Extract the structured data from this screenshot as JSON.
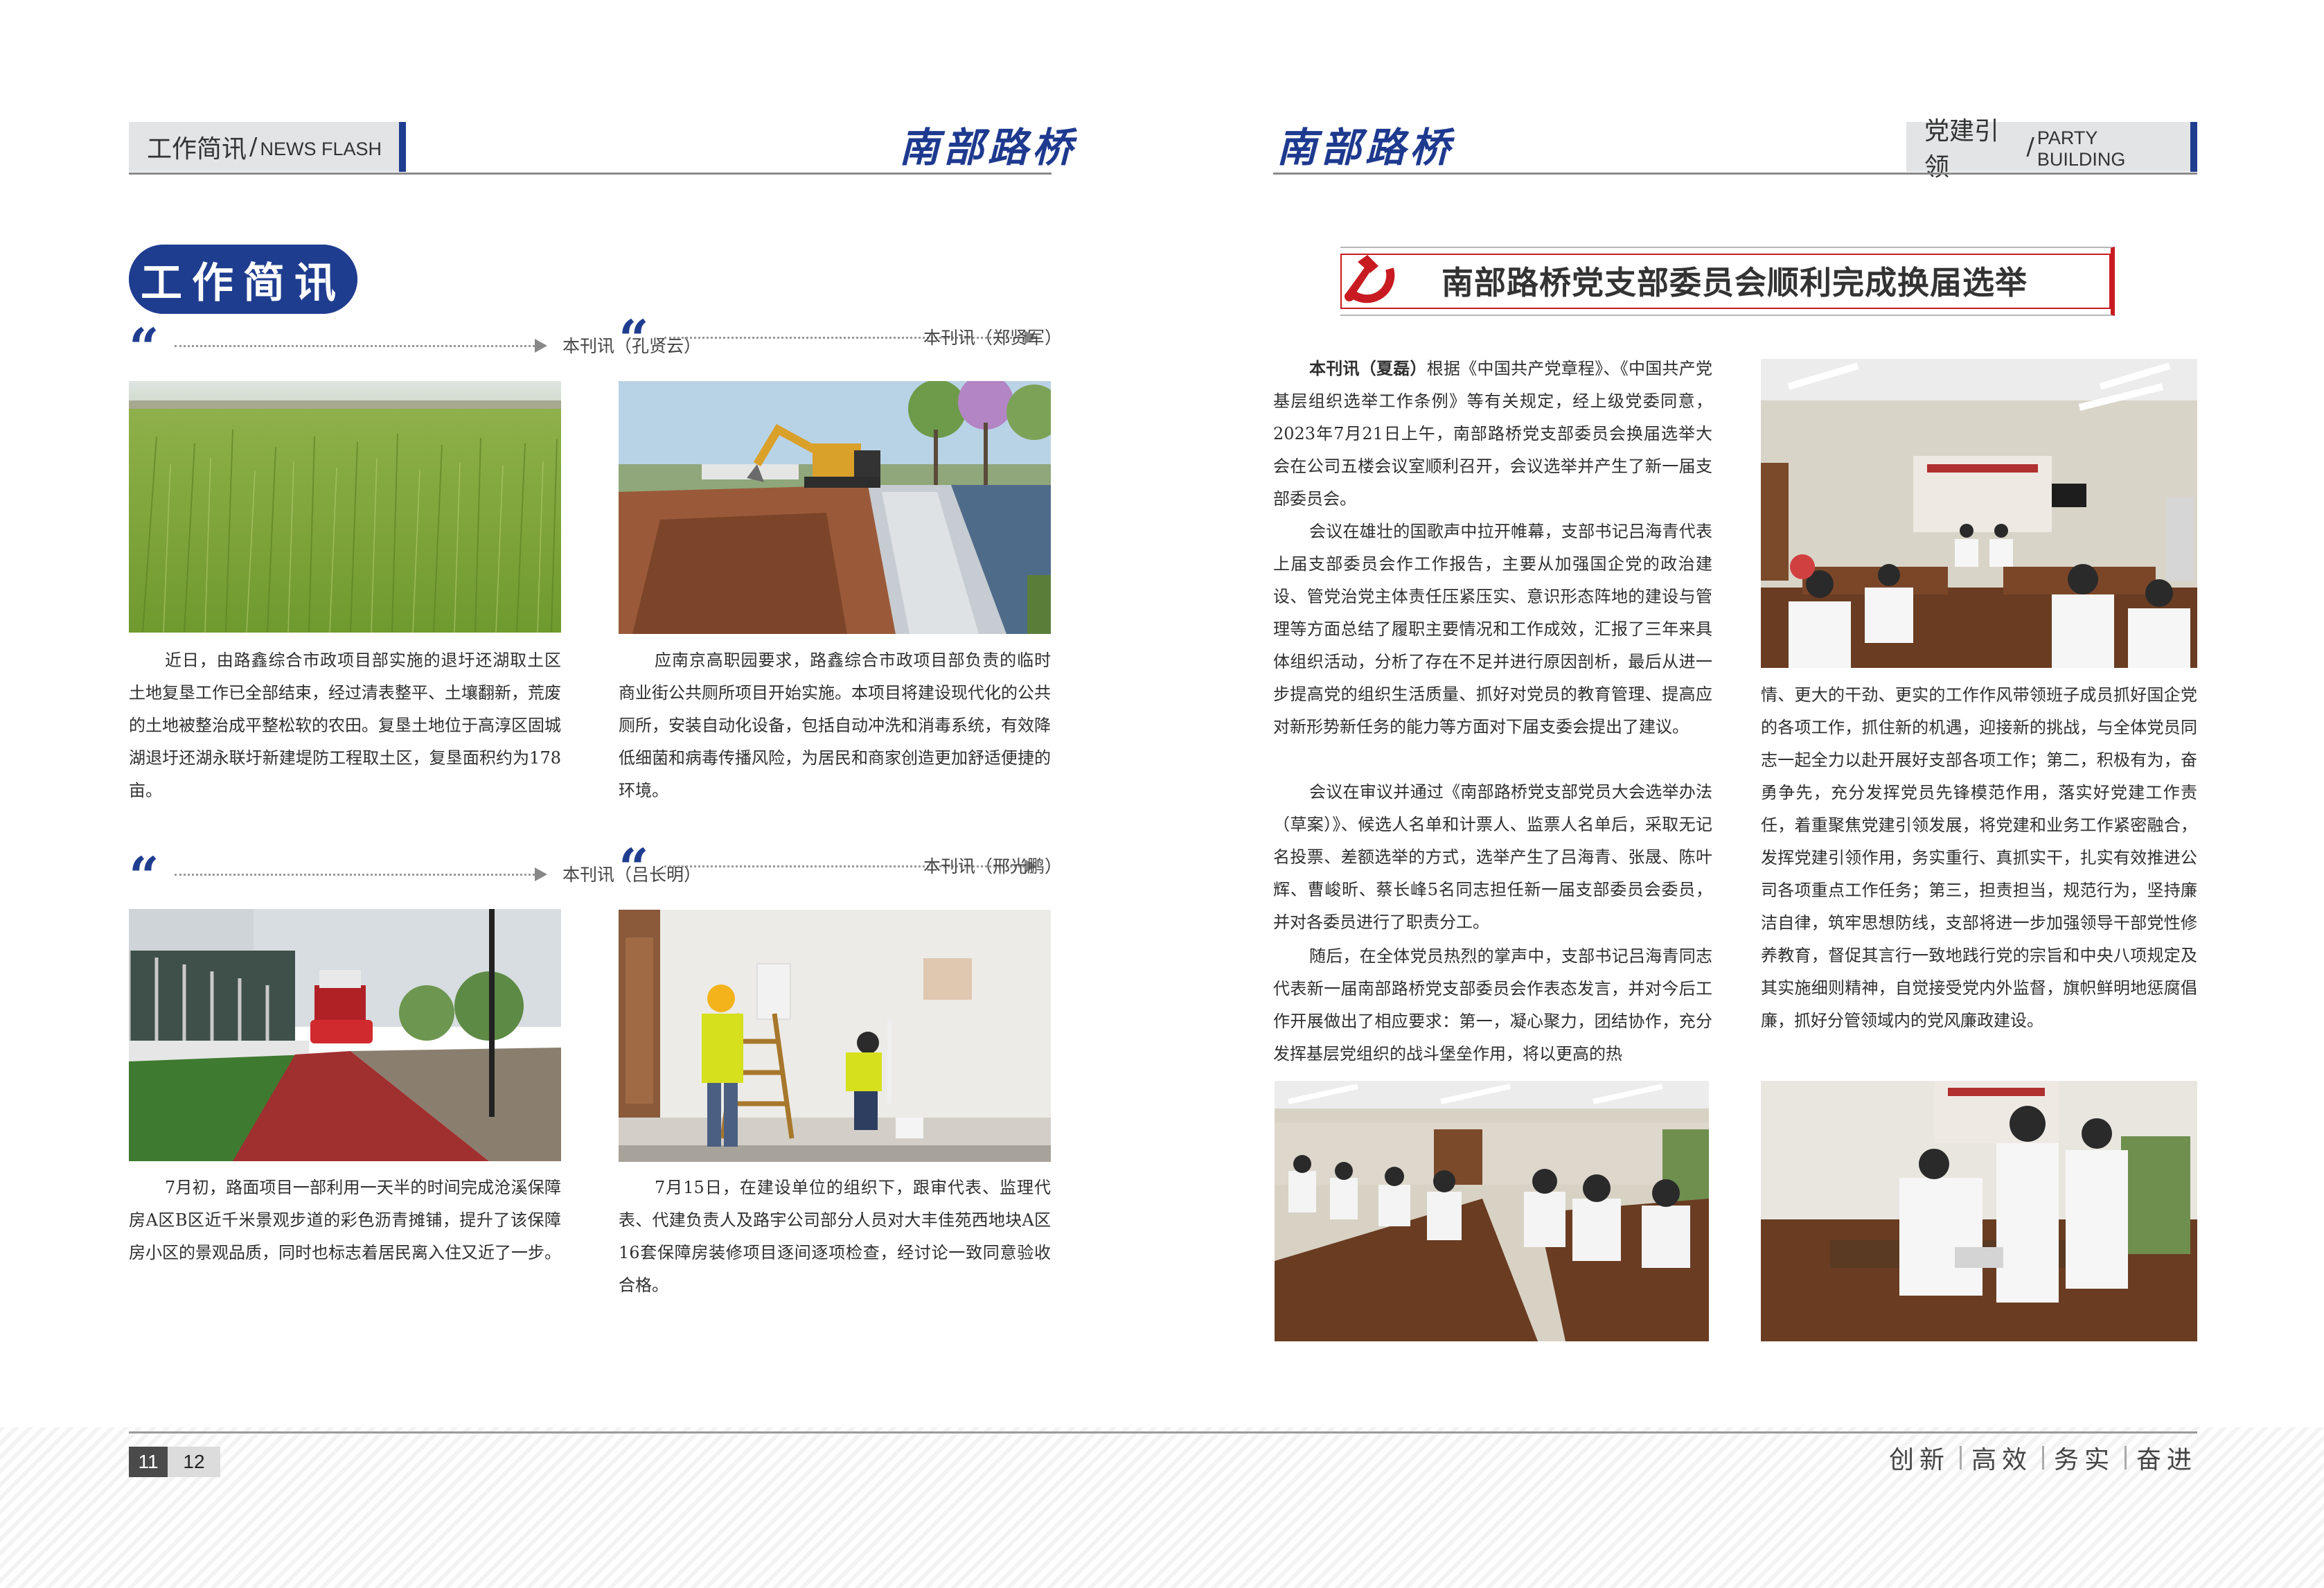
{
  "left_header": {
    "section_zh": "工作简讯",
    "section_en": "NEWS FLASH",
    "brand": "南部路桥"
  },
  "right_header": {
    "section_zh": "党建引领",
    "section_en": "PARTY BUILDING",
    "brand": "南部路桥"
  },
  "news_title": "工作简讯",
  "news": [
    {
      "byline": "本刊讯（孔贤云）",
      "photo": "rice-field-photo",
      "text": "近日，由路鑫综合市政项目部实施的退圩还湖取土区土地复垦工作已全部结束，经过清表整平、土壤翻新，荒废的土地被整治成平整松软的农田。复垦土地位于高淳区固城湖退圩还湖永联圩新建堤防工程取土区，复垦面积约为178亩。"
    },
    {
      "byline": "本刊讯（郑贤军）",
      "photo": "excavator-photo",
      "text": "应南京高职园要求，路鑫综合市政项目部负责的临时商业街公共厕所项目开始实施。本项目将建设现代化的公共厕所，安装自动化设备，包括自动冲洗和消毒系统，有效降低细菌和病毒传播风险，为居民和商家创造更加舒适便捷的环境。"
    },
    {
      "byline": "本刊讯（吕长明）",
      "photo": "road-roller-photo",
      "text": "7月初，路面项目一部利用一天半的时间完成沧溪保障房A区B区近千米景观步道的彩色沥青摊铺，提升了该保障房小区的景观品质，同时也标志着居民离入住又近了一步。"
    },
    {
      "byline": "本刊讯（邢光鹏）",
      "photo": "inspection-photo",
      "text": "7月15日，在建设单位的组织下，跟审代表、监理代表、代建负责人及路宇公司部分人员对大丰佳苑西地块A区16套保障房装修项目逐间逐项检查，经讨论一致同意验收合格。"
    }
  ],
  "article": {
    "title": "南部路桥党支部委员会顺利完成换届选举",
    "byline": "本刊讯（夏磊）",
    "p1": "根据《中国共产党章程》、《中国共产党基层组织选举工作条例》等有关规定，经上级党委同意，2023年7月21日上午，南部路桥党支部委员会换届选举大会在公司五楼会议室顺利召开，会议选举并产生了新一届支部委员会。",
    "p2": "会议在雄壮的国歌声中拉开帷幕，支部书记吕海青代表上届支部委员会作工作报告，主要从加强国企党的政治建设、管党治党主体责任压紧压实、意识形态阵地的建设与管理等方面总结了履职主要情况和工作成效，汇报了三年来具体组织活动，分析了存在不足并进行原因剖析，最后从进一步提高党的组织生活质量、抓好对党员的教育管理、提高应对新形势新任务的能力等方面对下届支委会提出了建议。",
    "p3": "会议在审议并通过《南部路桥党支部党员大会选举办法（草案）》、候选人名单和计票人、监票人名单后，采取无记名投票、差额选举的方式，选举产生了吕海青、张晟、陈叶辉、曹峻昕、蔡长峰5名同志担任新一届支部委员会委员，并对各委员进行了职责分工。",
    "p4": "随后，在全体党员热烈的掌声中，支部书记吕海青同志代表新一届南部路桥党支部委员会作表态发言，并对今后工作开展做出了相应要求：第一，凝心聚力，团结协作，充分发挥基层党组织的战斗堡垒作用，将以更高的热",
    "p4_cont": "情、更大的干劲、更实的工作作风带领班子成员抓好国企党的各项工作，抓住新的机遇，迎接新的挑战，与全体党员同志一起全力以赴开展好支部各项工作；第二，积极有为，奋勇争先，充分发挥党员先锋模范作用，落实好党建工作责任，着重聚焦党建引领发展，将党建和业务工作紧密融合，发挥党建引领作用，务实重行、真抓实干，扎实有效推进公司各项重点工作任务；第三，担责担当，规范行为，坚持廉洁自律，筑牢思想防线，支部将进一步加强领导干部党性修养教育，督促其言行一致地践行党的宗旨和中央八项规定及其实施细则精神，自觉接受党内外监督，旗帜鲜明地惩腐倡廉，抓好分管领域内的党风廉政建设。",
    "photos": [
      "meeting-room-photo",
      "voting-photo",
      "ballot-casting-photo"
    ]
  },
  "footer": {
    "page_left": "11",
    "page_right": "12",
    "slogan": [
      "创新",
      "高效",
      "务实",
      "奋进"
    ]
  },
  "colors": {
    "brand_blue": "#1f3d8f",
    "party_red": "#c81b21"
  }
}
